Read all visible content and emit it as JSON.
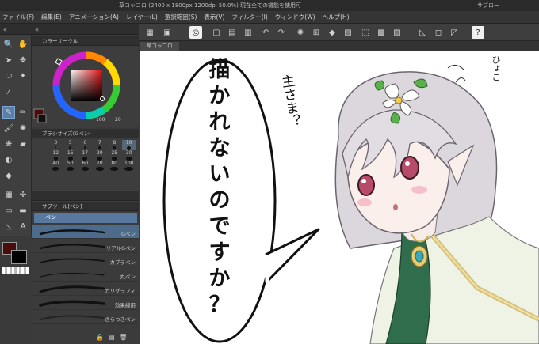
{
  "window": {
    "title": "草コッコロ (2400 x 1800px 1200dpi 50.0%)  現在全ての機能を使用可",
    "title_right": "サブロー"
  },
  "menu": [
    "ファイル(F)",
    "編集(E)",
    "アニメーション(A)",
    "レイヤー(L)",
    "選択範囲(S)",
    "表示(V)",
    "フィルター(I)",
    "ウィンドウ(W)",
    "ヘルプ(H)"
  ],
  "panels": {
    "color_circle": "カラーサークル",
    "color_values": {
      "hue": "100",
      "value": "20"
    },
    "brush_size": "ブラシサイズ(Gペン)",
    "brush_sizes": [
      "3",
      "5",
      "6",
      "7",
      "8",
      "10",
      "12",
      "15",
      "17",
      "20",
      "25",
      "30",
      "40",
      "50",
      "60",
      "70",
      "80",
      "100"
    ],
    "subtool": "サブツール[ペン]",
    "subtool_group": "ペン",
    "brushes": [
      "Gペン",
      "リアルGペン",
      "カブラペン",
      "丸ペン",
      "カリグラフィ",
      "効果線用",
      "ざらつきペン"
    ]
  },
  "canvas": {
    "tab": "草コッコロ",
    "speech_bubble": [
      "描",
      "か",
      "れ",
      "な",
      "い",
      "の",
      "で",
      "す",
      "か",
      "？"
    ],
    "side_note": "主さま？",
    "sound_effect": "ひょこ"
  },
  "colors": {
    "main": "#4a0d0d",
    "sub": "#000000",
    "accent": "#5a7fa8"
  }
}
